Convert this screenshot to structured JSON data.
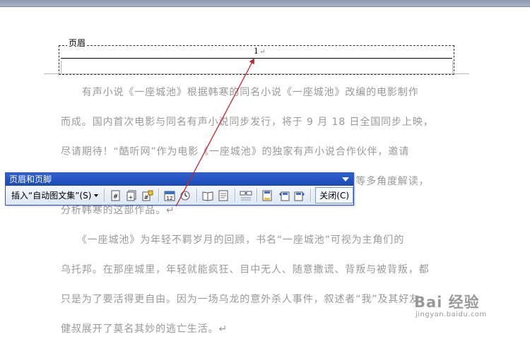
{
  "page": {
    "header_label": "页眉",
    "header_page_number": "1",
    "paragraph_mark": "↵"
  },
  "body": {
    "lines": [
      "　　有声小说《一座城池》根据韩寒的同名小说《一座城池》改编的电影制作",
      "而成。国内首次电影与同名有声小说同步发行，将于 9 月 18 日全国同步上映，",
      "尽请期待！“酷听网”作为电影《一座城池》的独家有声小说合作伙伴，邀请",
      "　　　　　　　　　　　　　　　　　　　　　　　　　　编剧等多角度解读，",
      "分析韩寒的这部作品。↵",
      "　　《一座城池》为年轻不羁岁月的回顾，书名“一座城池”可视为主角们的",
      "乌托邦。在那座城里，年轻就能疯狂、目中无人、随意撒谎、背叛与被背叛，都",
      "只是为了要活得更自由。因为一场乌龙的意外杀人事件，叙述者“我”及其好友",
      "健叔展开了莫名其妙的逃亡生活。↵"
    ]
  },
  "toolbar": {
    "title": "页眉和页脚",
    "autotext_label": "插入“自动图文集”(S)",
    "close_label": "关闭(C)",
    "buttons": [
      "insert-page-number-icon",
      "insert-page-count-icon",
      "format-page-number-icon",
      "insert-date-icon",
      "insert-time-icon",
      "page-setup-icon",
      "show-document-text-icon",
      "same-as-previous-icon",
      "switch-header-footer-icon",
      "show-previous-icon",
      "show-next-icon"
    ]
  },
  "watermark": {
    "main": "Bai 经验",
    "sub": "jingyan.baidu.com"
  },
  "colors": {
    "toolbar_title": "#2155c5",
    "annotation_arrow": "#c4242a",
    "body_text": "#999999"
  }
}
